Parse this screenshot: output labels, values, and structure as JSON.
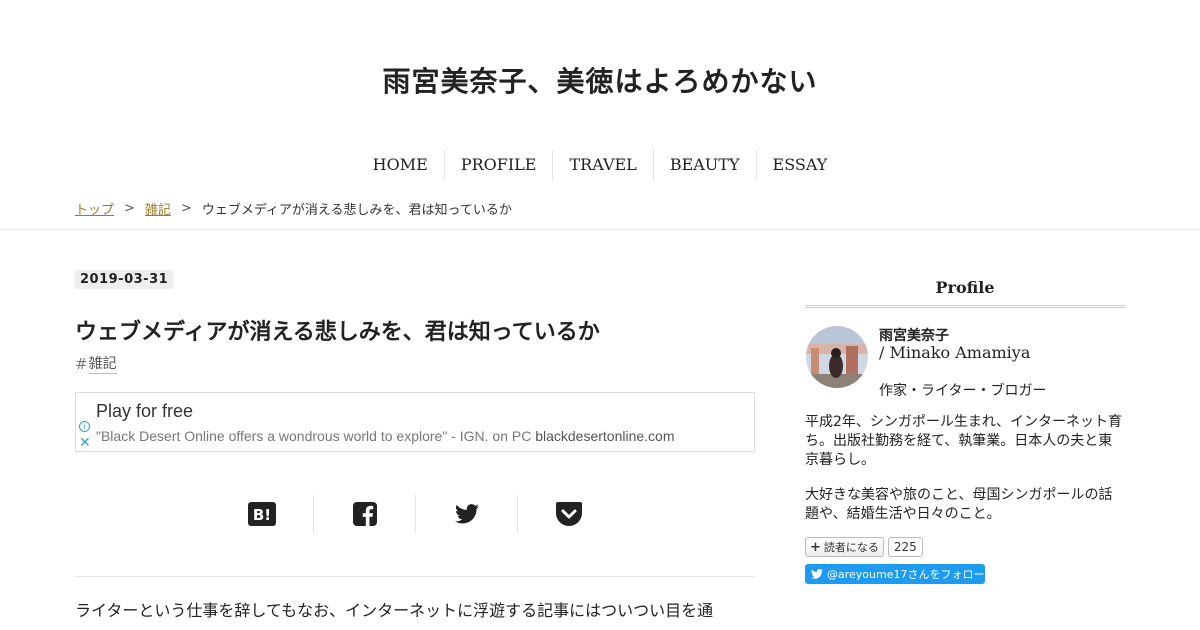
{
  "site": {
    "title": "雨宮美奈子、美徳はよろめかない"
  },
  "nav": {
    "items": [
      "HOME",
      "PROFILE",
      "TRAVEL",
      "BEAUTY",
      "ESSAY"
    ]
  },
  "breadcrumb": {
    "top": "トップ",
    "category": "雑記",
    "current": "ウェブメディアが消える悲しみを、君は知っているか",
    "separator": ">"
  },
  "entry": {
    "date": "2019-03-31",
    "title": "ウェブメディアが消える悲しみを、君は知っているか",
    "category_hash": "#",
    "category": "雑記",
    "body_first_line": "ライターという仕事を辞してもなお、インターネットに浮遊する記事にはついつい目を通"
  },
  "ad": {
    "title": "Play for free",
    "description": "\"Black Desert Online offers a wondrous world to explore\" - IGN. on PC ",
    "url": "blackdesertonline.com",
    "info_glyph": "i",
    "close_glyph": "✕"
  },
  "share": {
    "icons": [
      "hatena-bookmark-icon",
      "facebook-icon",
      "twitter-icon",
      "pocket-icon"
    ],
    "hatena_label": "B!"
  },
  "sidebar": {
    "heading": "Profile",
    "name": "雨宮美奈子",
    "name_en": "/ Minako Amamiya",
    "role": "作家・ライター・ブロガー",
    "desc1": "平成2年、シンガポール生まれ、インターネット育ち。出版社勤務を経て、執筆業。日本人の夫と東京暮らし。",
    "desc2": "大好きな美容や旅のこと、母国シンガポールの話題や、結婚生活や日々のこと。",
    "subscribe_label": "読者になる",
    "subscribe_plus": "+",
    "subscriber_count": "225",
    "twitter_follow": "@areyoume17さんをフォロー"
  },
  "colors": {
    "link": "#9b7b2a",
    "twitter": "#1d9bf0",
    "ad_icon": "#3b9cd6"
  }
}
